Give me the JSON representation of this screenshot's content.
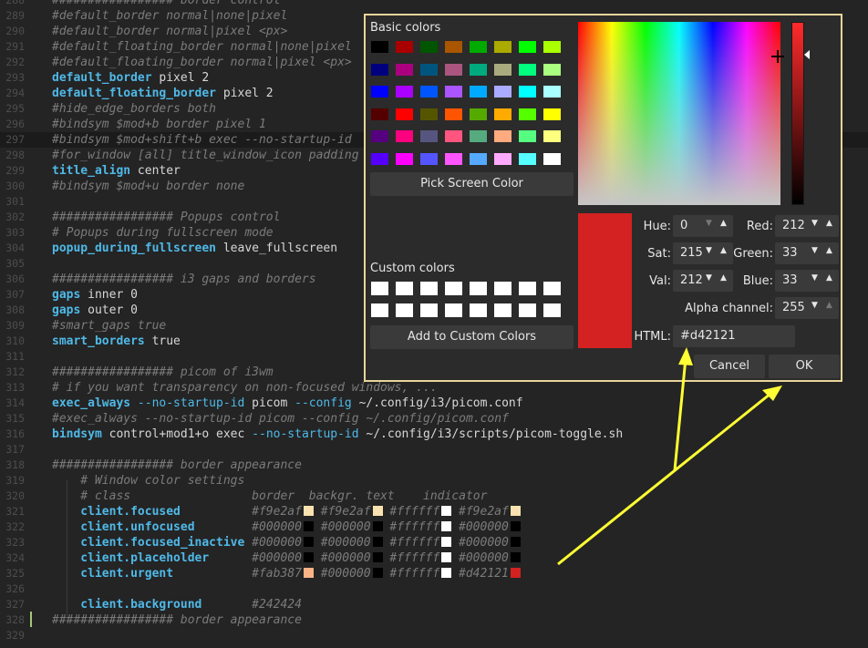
{
  "editor": {
    "lines": [
      {
        "n": "288",
        "segs": [
          {
            "c": "cm",
            "t": "################# border control"
          }
        ]
      },
      {
        "n": "289",
        "segs": [
          {
            "c": "cm",
            "t": "#default_border normal|none|pixel"
          }
        ]
      },
      {
        "n": "290",
        "segs": [
          {
            "c": "cm",
            "t": "#default_border normal|pixel <px>"
          }
        ]
      },
      {
        "n": "291",
        "segs": [
          {
            "c": "cm",
            "t": "#default_floating_border normal|none|pixel"
          }
        ]
      },
      {
        "n": "292",
        "segs": [
          {
            "c": "cm",
            "t": "#default_floating_border normal|pixel <px>"
          }
        ]
      },
      {
        "n": "293",
        "segs": [
          {
            "c": "kw",
            "t": "default_border"
          },
          {
            "c": "tx",
            "t": " pixel 2"
          }
        ]
      },
      {
        "n": "294",
        "segs": [
          {
            "c": "kw",
            "t": "default_floating_border"
          },
          {
            "c": "tx",
            "t": " pixel 2"
          }
        ]
      },
      {
        "n": "295",
        "segs": [
          {
            "c": "cm",
            "t": "#hide_edge_borders both"
          }
        ]
      },
      {
        "n": "296",
        "segs": [
          {
            "c": "cm",
            "t": "#bindsym $mod+b border pixel 1"
          }
        ]
      },
      {
        "n": "297",
        "cur": true,
        "segs": [
          {
            "c": "cm",
            "t": "#bindsym $mod+shift+b exec --no-startup-id"
          }
        ]
      },
      {
        "n": "298",
        "segs": [
          {
            "c": "cm",
            "t": "#for_window [all] title_window_icon padding"
          }
        ]
      },
      {
        "n": "299",
        "segs": [
          {
            "c": "kw",
            "t": "title_align"
          },
          {
            "c": "tx",
            "t": " center"
          }
        ]
      },
      {
        "n": "300",
        "segs": [
          {
            "c": "cm",
            "t": "#bindsym $mod+u border none"
          }
        ]
      },
      {
        "n": "301",
        "segs": []
      },
      {
        "n": "302",
        "segs": [
          {
            "c": "cm",
            "t": "################# Popups control"
          }
        ]
      },
      {
        "n": "303",
        "segs": [
          {
            "c": "cm",
            "t": "# Popups during fullscreen mode"
          }
        ]
      },
      {
        "n": "304",
        "segs": [
          {
            "c": "kw",
            "t": "popup_during_fullscreen"
          },
          {
            "c": "tx",
            "t": " leave_fullscreen"
          }
        ]
      },
      {
        "n": "305",
        "segs": []
      },
      {
        "n": "306",
        "segs": [
          {
            "c": "cm",
            "t": "################# i3 gaps and borders"
          }
        ]
      },
      {
        "n": "307",
        "segs": [
          {
            "c": "kw",
            "t": "gaps"
          },
          {
            "c": "tx",
            "t": " inner 0"
          }
        ]
      },
      {
        "n": "308",
        "segs": [
          {
            "c": "kw",
            "t": "gaps"
          },
          {
            "c": "tx",
            "t": " outer 0"
          }
        ]
      },
      {
        "n": "309",
        "segs": [
          {
            "c": "cm",
            "t": "#smart_gaps true"
          }
        ]
      },
      {
        "n": "310",
        "segs": [
          {
            "c": "kw",
            "t": "smart_borders"
          },
          {
            "c": "tx",
            "t": " true"
          }
        ]
      },
      {
        "n": "311",
        "segs": []
      },
      {
        "n": "312",
        "segs": [
          {
            "c": "cm",
            "t": "################# picom of i3wm"
          }
        ]
      },
      {
        "n": "313",
        "segs": [
          {
            "c": "cm",
            "t": "# if you want transparency on non-focused windows, ..."
          }
        ]
      },
      {
        "n": "314",
        "segs": [
          {
            "c": "kw",
            "t": "exec_always"
          },
          {
            "c": "fl",
            "t": " --no-startup-id"
          },
          {
            "c": "tx",
            "t": " picom "
          },
          {
            "c": "fl",
            "t": "--config"
          },
          {
            "c": "tx",
            "t": " ~/.config/i3/picom.conf"
          }
        ]
      },
      {
        "n": "315",
        "segs": [
          {
            "c": "cm",
            "t": "#exec_always --no-startup-id picom --config ~/.config/picom.conf"
          }
        ]
      },
      {
        "n": "316",
        "segs": [
          {
            "c": "kw",
            "t": "bindsym"
          },
          {
            "c": "tx",
            "t": " control+mod1+o exec "
          },
          {
            "c": "fl",
            "t": "--no-startup-id"
          },
          {
            "c": "tx",
            "t": " ~/.config/i3/scripts/picom-toggle.sh"
          }
        ]
      },
      {
        "n": "317",
        "segs": []
      },
      {
        "n": "318",
        "segs": [
          {
            "c": "cm",
            "t": "################# border appearance"
          }
        ]
      },
      {
        "n": "319",
        "segs": [
          {
            "c": "cm",
            "t": "    # Window color settings"
          }
        ]
      },
      {
        "n": "320",
        "segs": [
          {
            "c": "cm",
            "t": "    # class                 border  backgr. text    indicator"
          }
        ]
      },
      {
        "n": "321",
        "segs": [
          {
            "c": "kw",
            "t": "    client.focused"
          },
          {
            "c": "cm",
            "t": "          #f9e2af"
          },
          {
            "c": "sw",
            "t": "#f9e2af"
          },
          {
            "c": "cm",
            "t": " #f9e2af"
          },
          {
            "c": "sw",
            "t": "#f9e2af"
          },
          {
            "c": "cm",
            "t": " #ffffff"
          },
          {
            "c": "sw",
            "t": "#ffffff"
          },
          {
            "c": "cm",
            "t": " #f9e2af"
          },
          {
            "c": "sw",
            "t": "#f9e2af"
          }
        ]
      },
      {
        "n": "322",
        "segs": [
          {
            "c": "kw",
            "t": "    client.unfocused"
          },
          {
            "c": "cm",
            "t": "        #000000"
          },
          {
            "c": "sw",
            "t": "#000000"
          },
          {
            "c": "cm",
            "t": " #000000"
          },
          {
            "c": "sw",
            "t": "#000000"
          },
          {
            "c": "cm",
            "t": " #ffffff"
          },
          {
            "c": "sw",
            "t": "#ffffff"
          },
          {
            "c": "cm",
            "t": " #000000"
          },
          {
            "c": "sw",
            "t": "#000000"
          }
        ]
      },
      {
        "n": "323",
        "segs": [
          {
            "c": "kw",
            "t": "    client.focused_inactive"
          },
          {
            "c": "cm",
            "t": " #000000"
          },
          {
            "c": "sw",
            "t": "#000000"
          },
          {
            "c": "cm",
            "t": " #000000"
          },
          {
            "c": "sw",
            "t": "#000000"
          },
          {
            "c": "cm",
            "t": " #ffffff"
          },
          {
            "c": "sw",
            "t": "#ffffff"
          },
          {
            "c": "cm",
            "t": " #000000"
          },
          {
            "c": "sw",
            "t": "#000000"
          }
        ]
      },
      {
        "n": "324",
        "segs": [
          {
            "c": "kw",
            "t": "    client.placeholder"
          },
          {
            "c": "cm",
            "t": "      #000000"
          },
          {
            "c": "sw",
            "t": "#000000"
          },
          {
            "c": "cm",
            "t": " #000000"
          },
          {
            "c": "sw",
            "t": "#000000"
          },
          {
            "c": "cm",
            "t": " #ffffff"
          },
          {
            "c": "sw",
            "t": "#ffffff"
          },
          {
            "c": "cm",
            "t": " #000000"
          },
          {
            "c": "sw",
            "t": "#000000"
          }
        ]
      },
      {
        "n": "325",
        "segs": [
          {
            "c": "kw",
            "t": "    client.urgent"
          },
          {
            "c": "cm",
            "t": "           #fab387"
          },
          {
            "c": "sw",
            "t": "#fab387"
          },
          {
            "c": "cm",
            "t": " #000000"
          },
          {
            "c": "sw",
            "t": "#000000"
          },
          {
            "c": "cm",
            "t": " #ffffff"
          },
          {
            "c": "sw",
            "t": "#ffffff"
          },
          {
            "c": "cm",
            "t": " #d42121"
          },
          {
            "c": "sw",
            "t": "#d42121"
          }
        ]
      },
      {
        "n": "326",
        "segs": []
      },
      {
        "n": "327",
        "segs": [
          {
            "c": "kw",
            "t": "    client.background"
          },
          {
            "c": "cm",
            "t": "       #242424"
          },
          {
            "c": "sw",
            "t": "#242424"
          }
        ]
      },
      {
        "n": "328",
        "segs": [
          {
            "c": "cm",
            "t": "################# border appearance"
          }
        ]
      },
      {
        "n": "329",
        "segs": []
      }
    ]
  },
  "dialog": {
    "basic_colors_label": "Basic colors",
    "basic_colors": [
      "#000000",
      "#aa0000",
      "#005500",
      "#aa5500",
      "#00aa00",
      "#aaaa00",
      "#00ff00",
      "#aaff00",
      "#00007f",
      "#aa007f",
      "#00557f",
      "#aa557f",
      "#00aa7f",
      "#aaaa7f",
      "#00ff7f",
      "#aaff7f",
      "#0000ff",
      "#aa00ff",
      "#0055ff",
      "#aa55ff",
      "#00aaff",
      "#aaaaff",
      "#00ffff",
      "#aaffff",
      "#550000",
      "#ff0000",
      "#555500",
      "#ff5500",
      "#55aa00",
      "#ffaa00",
      "#55ff00",
      "#ffff00",
      "#55007f",
      "#ff007f",
      "#55557f",
      "#ff557f",
      "#55aa7f",
      "#ffaa7f",
      "#55ff7f",
      "#ffff7f",
      "#5500ff",
      "#ff00ff",
      "#5555ff",
      "#ff55ff",
      "#55aaff",
      "#ffaaff",
      "#55ffff",
      "#ffffff"
    ],
    "pick_screen_color": "Pick Screen Color",
    "custom_colors_label": "Custom colors",
    "custom_colors": [
      "#ffffff",
      "#ffffff",
      "#ffffff",
      "#ffffff",
      "#ffffff",
      "#ffffff",
      "#ffffff",
      "#ffffff",
      "#ffffff",
      "#ffffff",
      "#ffffff",
      "#ffffff",
      "#ffffff",
      "#ffffff",
      "#ffffff",
      "#ffffff"
    ],
    "add_to_custom": "Add to Custom Colors",
    "current_color": "#d42121",
    "hue_label": "Hue:",
    "hue": "0",
    "sat_label": "Sat:",
    "sat": "215",
    "val_label": "Val:",
    "val": "212",
    "red_label": "Red:",
    "red": "212",
    "green_label": "Green:",
    "green": "33",
    "blue_label": "Blue:",
    "blue": "33",
    "alpha_label": "Alpha channel:",
    "alpha": "255",
    "html_label": "HTML:",
    "html": "#d42121",
    "cancel": "Cancel",
    "ok": "OK"
  },
  "annotation_color": "#ffff33"
}
